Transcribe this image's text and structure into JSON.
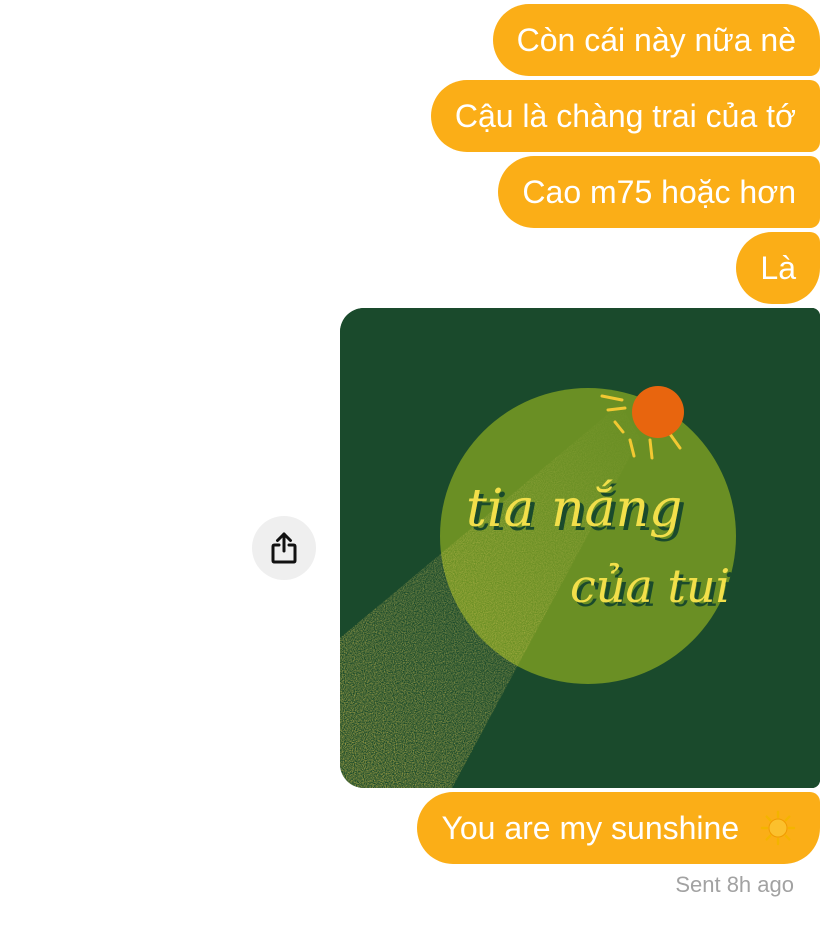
{
  "messages": [
    {
      "text": "Còn cái này nữa nè"
    },
    {
      "text": "Cậu là chàng trai của tớ"
    },
    {
      "text": "Cao m75 hoặc hơn"
    },
    {
      "text": "Là"
    },
    {
      "text": "You are my sunshine"
    }
  ],
  "image": {
    "line1": "tia nắng",
    "line2": "của tui"
  },
  "share_icon": "share-icon",
  "sun_emoji_icon": "sun-emoji-icon",
  "status": "Sent 8h ago",
  "colors": {
    "bubble": "#FBAE17",
    "image_bg": "#1a4a2c",
    "circle": "#6a8f24",
    "sun": "#e8650e",
    "lettering": "#f2df4a",
    "status_text": "#a2a2a2"
  }
}
